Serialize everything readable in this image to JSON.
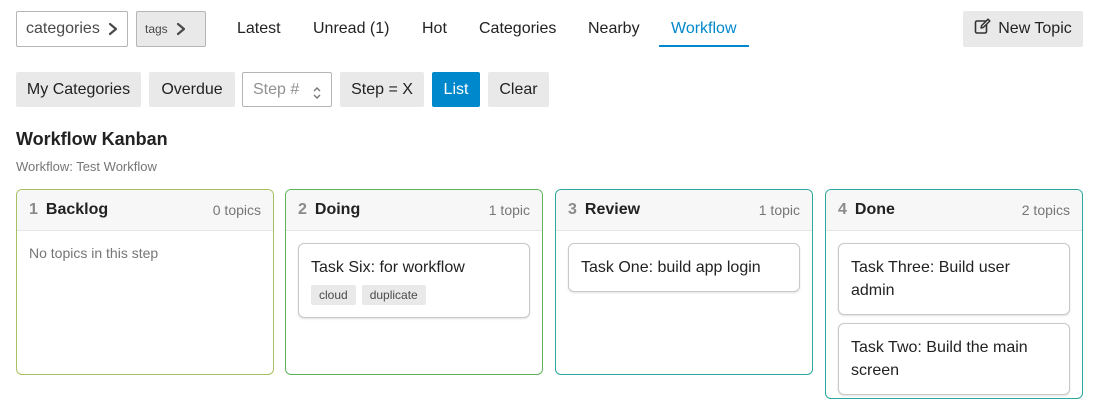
{
  "nav": {
    "categories_dropdown": "categories",
    "tags_dropdown": "tags",
    "links": [
      "Latest",
      "Unread (1)",
      "Hot",
      "Categories",
      "Nearby",
      "Workflow"
    ],
    "active_link": "Workflow",
    "new_topic": "New Topic"
  },
  "filters": {
    "my_categories": "My Categories",
    "overdue": "Overdue",
    "step_placeholder": "Step #",
    "step_equals": "Step = X",
    "list": "List",
    "clear": "Clear"
  },
  "heading": {
    "title": "Workflow Kanban",
    "subtitle": "Workflow: Test Workflow"
  },
  "columns": [
    {
      "number": "1",
      "name": "Backlog",
      "count": "0 topics",
      "border_color": "#a8c060",
      "empty_text": "No topics in this step",
      "cards": []
    },
    {
      "number": "2",
      "name": "Doing",
      "count": "1 topic",
      "border_color": "#5cb55c",
      "cards": [
        {
          "title": "Task Six: for workflow",
          "tags": [
            "cloud",
            "duplicate"
          ]
        }
      ]
    },
    {
      "number": "3",
      "name": "Review",
      "count": "1 topic",
      "border_color": "#2aa79e",
      "cards": [
        {
          "title": "Task One: build app login",
          "tags": []
        }
      ]
    },
    {
      "number": "4",
      "name": "Done",
      "count": "2 topics",
      "border_color": "#2aa79e",
      "cards": [
        {
          "title": "Task Three: Build user admin",
          "tags": []
        },
        {
          "title": "Task Two: Build the main screen",
          "tags": []
        }
      ]
    }
  ],
  "colors": {
    "accent": "#0088cc",
    "button_bg": "#e9e9e9"
  }
}
